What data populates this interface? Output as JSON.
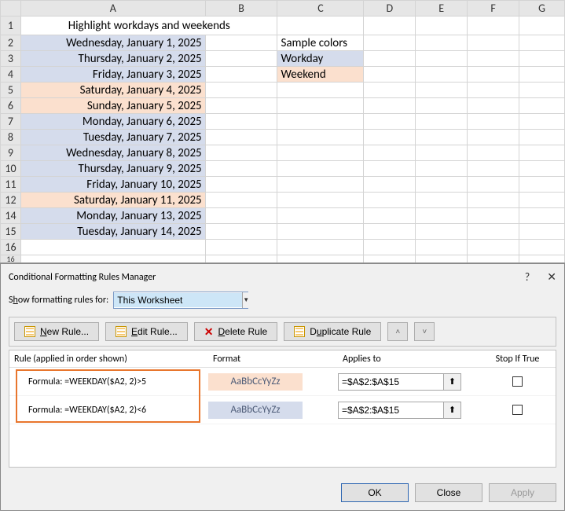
{
  "sheet": {
    "colHeaders": [
      "",
      "A",
      "B",
      "C",
      "D",
      "E",
      "F",
      "G"
    ],
    "rows": [
      {
        "n": "1",
        "A": "Highlight workdays and weekends",
        "format": "title"
      },
      {
        "n": "2",
        "A": "Wednesday, January 1, 2025",
        "C": "Sample colors",
        "Cfmt": "bold",
        "Afmt": "bg-blue"
      },
      {
        "n": "3",
        "A": "Thursday, January 2, 2025",
        "C": "Workday",
        "Cfmt": "bg-blue",
        "Afmt": "bg-blue"
      },
      {
        "n": "4",
        "A": "Friday, January 3, 2025",
        "C": "Weekend",
        "Cfmt": "bg-peach",
        "Afmt": "bg-blue"
      },
      {
        "n": "5",
        "A": "Saturday, January 4, 2025",
        "Afmt": "bg-peach"
      },
      {
        "n": "6",
        "A": "Sunday, January 5, 2025",
        "Afmt": "bg-peach"
      },
      {
        "n": "7",
        "A": "Monday, January 6, 2025",
        "Afmt": "bg-blue"
      },
      {
        "n": "8",
        "A": "Tuesday, January 7, 2025",
        "Afmt": "bg-blue"
      },
      {
        "n": "9",
        "A": "Wednesday, January 8, 2025",
        "Afmt": "bg-blue"
      },
      {
        "n": "10",
        "A": "Thursday, January 9, 2025",
        "Afmt": "bg-blue"
      },
      {
        "n": "11",
        "A": "Friday, January 10, 2025",
        "Afmt": "bg-blue"
      },
      {
        "n": "12",
        "A": "Saturday, January 11, 2025",
        "Afmt": "bg-peach"
      },
      {
        "n": "14",
        "A": "Monday, January 13, 2025",
        "Afmt": "bg-blue"
      },
      {
        "n": "15",
        "A": "Tuesday, January 14, 2025",
        "Afmt": "bg-blue"
      },
      {
        "n": "16",
        "A": ""
      }
    ],
    "truncRow": "16"
  },
  "dialog": {
    "title": "Conditional Formatting Rules Manager",
    "help": "?",
    "close": "✕",
    "showLabelPre": "S",
    "showLabelU": "h",
    "showLabelPost": "ow formatting rules for:",
    "showValue": "This Worksheet",
    "buttons": {
      "new": "New Rule...",
      "newU": "N",
      "edit": "Edit Rule...",
      "editU": "E",
      "delete": "Delete Rule",
      "deleteU": "D",
      "duplicate": "Duplicate Rule",
      "duplicateU": "u"
    },
    "cols": {
      "rule": "Rule (applied in order shown)",
      "format": "Format",
      "applies": "Applies to",
      "stop": "Stop If True"
    },
    "rules": [
      {
        "text": "Formula: =WEEKDAY($A2, 2)>5",
        "swatch": "bg-peach",
        "sample": "AaBbCcYyZz",
        "applies": "=$A$2:$A$15"
      },
      {
        "text": "Formula: =WEEKDAY($A2, 2)<6",
        "swatch": "bg-blue",
        "sample": "AaBbCcYyZz",
        "applies": "=$A$2:$A$15"
      }
    ],
    "footer": {
      "ok": "OK",
      "close": "Close",
      "apply": "Apply"
    }
  }
}
